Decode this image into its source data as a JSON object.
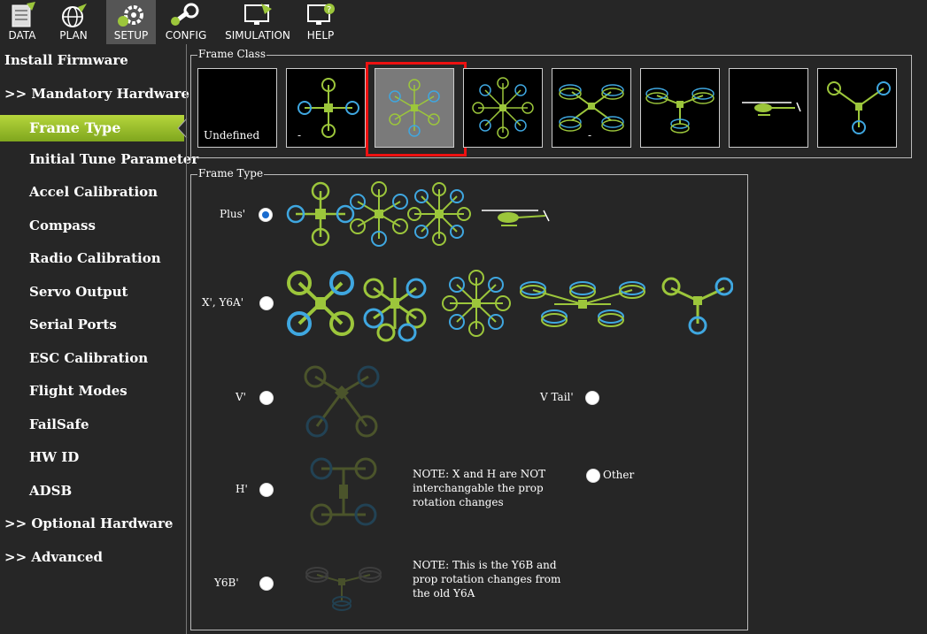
{
  "toolbar": {
    "items": [
      {
        "label": "DATA",
        "icon": "data-icon"
      },
      {
        "label": "PLAN",
        "icon": "plan-icon"
      },
      {
        "label": "SETUP",
        "icon": "setup-icon"
      },
      {
        "label": "CONFIG",
        "icon": "config-icon"
      },
      {
        "label": "SIMULATION",
        "icon": "simulation-icon"
      },
      {
        "label": "HELP",
        "icon": "help-icon"
      }
    ]
  },
  "sidebar": {
    "items": [
      {
        "label": "Install Firmware"
      },
      {
        "label": ">> Mandatory Hardware"
      },
      {
        "label": "Frame Type",
        "selected": true
      },
      {
        "label": "Initial Tune Parameter"
      },
      {
        "label": "Accel Calibration"
      },
      {
        "label": "Compass"
      },
      {
        "label": "Radio Calibration"
      },
      {
        "label": "Servo Output"
      },
      {
        "label": "Serial Ports"
      },
      {
        "label": "ESC Calibration"
      },
      {
        "label": "Flight Modes"
      },
      {
        "label": "FailSafe"
      },
      {
        "label": "HW ID"
      },
      {
        "label": "ADSB"
      },
      {
        "label": ">> Optional Hardware"
      },
      {
        "label": ">> Advanced"
      }
    ]
  },
  "frame_class": {
    "title": "Frame Class",
    "undefined_label": "Undefined",
    "dash": "-",
    "items": [
      "undefined",
      "quad",
      "hexa",
      "octa",
      "octa-quad",
      "y6",
      "heli",
      "tri"
    ],
    "selected_index": 2
  },
  "frame_type": {
    "title": "Frame Type",
    "plus_label": "Plus'",
    "x_label": "X', Y6A'",
    "v_label": "V'",
    "vtail_label": "V Tail'",
    "h_label": "H'",
    "y6b_label": "Y6B'",
    "other_label": "Other",
    "note_xh": "NOTE: X and H are NOT interchangable the prop rotation changes",
    "note_y6b": "NOTE: This is the Y6B and prop rotation changes from the old Y6A",
    "selected": "plus"
  },
  "colors": {
    "background": "#262626",
    "accent_green": "#9cc63b",
    "prop_blue": "#3fa7e0",
    "selection_red": "#e11111",
    "radio_blue": "#1a6ccf"
  }
}
